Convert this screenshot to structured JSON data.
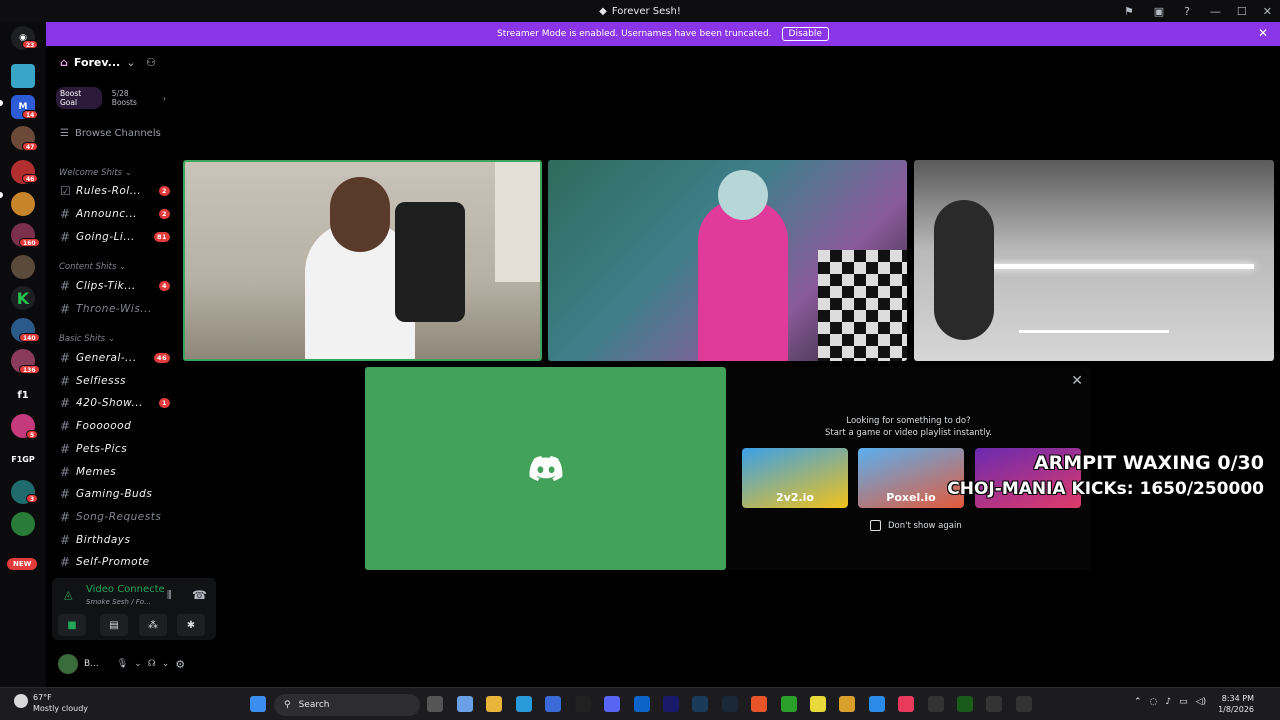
{
  "window": {
    "title": "Forever Sesh!"
  },
  "banner": {
    "text": "Streamer Mode is enabled. Usernames have been truncated.",
    "button": "Disable"
  },
  "rail": {
    "badges": [
      "23",
      "14",
      "47",
      "46",
      "160",
      "140",
      "136",
      "5",
      "3"
    ],
    "labels": {
      "f1": "f1",
      "f1gp": "F1GP",
      "new": "NEW"
    }
  },
  "server": {
    "name": "Forev...",
    "boost_label": "Boost Goal",
    "boost_count": "5/28 Boosts",
    "browse": "Browse Channels"
  },
  "categories": [
    {
      "label": "Welcome Shits"
    },
    {
      "label": "Content Shits"
    },
    {
      "label": "Basic Shits"
    }
  ],
  "channels": [
    {
      "name": "Rules-Rol...",
      "count": "2"
    },
    {
      "name": "Announc...",
      "count": "2"
    },
    {
      "name": "Going-Li...",
      "count": "81"
    },
    {
      "name": "Clips-Tik...",
      "count": "4"
    },
    {
      "name": "Throne-Wis...",
      "count": ""
    },
    {
      "name": "General-...",
      "count": "46"
    },
    {
      "name": "Selfiesss",
      "count": ""
    },
    {
      "name": "420-Show...",
      "count": "1"
    },
    {
      "name": "Fooooood",
      "count": ""
    },
    {
      "name": "Pets-Pics",
      "count": ""
    },
    {
      "name": "Memes",
      "count": ""
    },
    {
      "name": "Gaming-Buds",
      "count": ""
    },
    {
      "name": "Song-Requests",
      "count": ""
    },
    {
      "name": "Birthdays",
      "count": ""
    },
    {
      "name": "Self-Promote",
      "count": ""
    }
  ],
  "voice": {
    "status": "Video Connecte",
    "channel": "Smoke Sesh / Fo..."
  },
  "user": {
    "name": "B..."
  },
  "activity": {
    "line1": "Looking for something to do?",
    "line2": "Start a game or video playlist instantly.",
    "games": [
      "2v2.io",
      "Poxel.io",
      ""
    ],
    "checkbox": "Don't show again"
  },
  "overlay": {
    "line1": "ARMPIT WAXING 0/30",
    "line2": "CHOJ-MANIA KICKs: 1650/250000"
  },
  "taskbar": {
    "temp": "67°F",
    "weather": "Mostly cloudy",
    "search": "Search",
    "time": "8:34 PM",
    "date": "1/8/2026"
  },
  "colors": {
    "accent": "#8b35e9",
    "connected": "#23a55a",
    "badge": "#e23b3b",
    "discord_green": "#43a25a"
  }
}
